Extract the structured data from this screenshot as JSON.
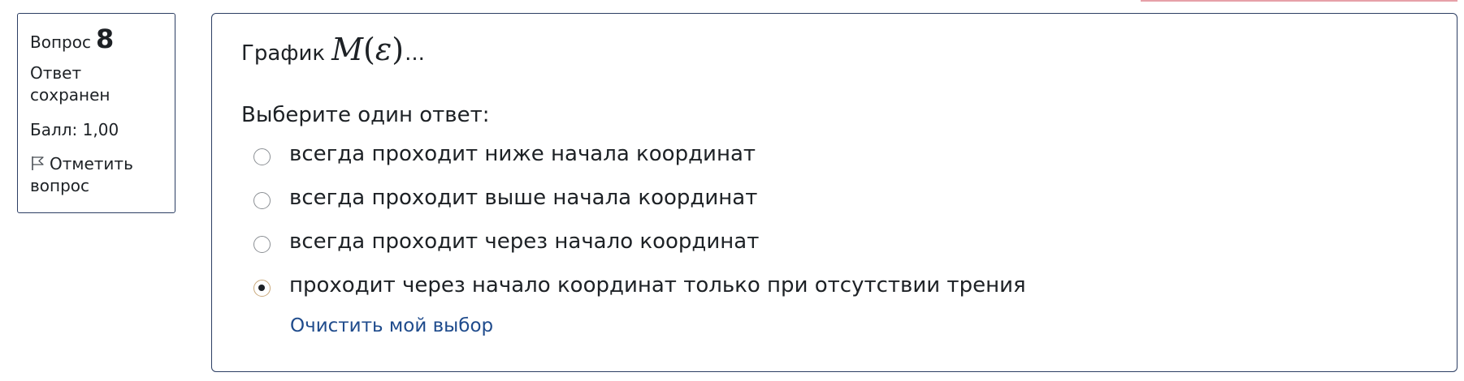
{
  "info": {
    "question_prefix": "Вопрос",
    "question_number": "8",
    "state": "Ответ сохранен",
    "grade": "Балл: 1,00",
    "flag_label": "Отметить вопрос"
  },
  "question": {
    "text_before": "График",
    "math_var": "M",
    "math_open": "(",
    "math_arg": "ε",
    "math_close": ")",
    "text_after": "...",
    "prompt": "Выберите один ответ:",
    "answers": [
      {
        "label": "всегда проходит ниже начала координат",
        "selected": false
      },
      {
        "label": "всегда проходит выше начала координат",
        "selected": false
      },
      {
        "label": "всегда проходит через начало координат",
        "selected": false
      },
      {
        "label": "проходит через начало координат только при отсутствии трения",
        "selected": true
      }
    ],
    "clear_label": "Очистить мой выбор"
  },
  "colors": {
    "border": "#2c3e63",
    "link": "#1f4b8c",
    "text": "#1d2125"
  },
  "icons": {
    "flag": "flag-icon"
  }
}
